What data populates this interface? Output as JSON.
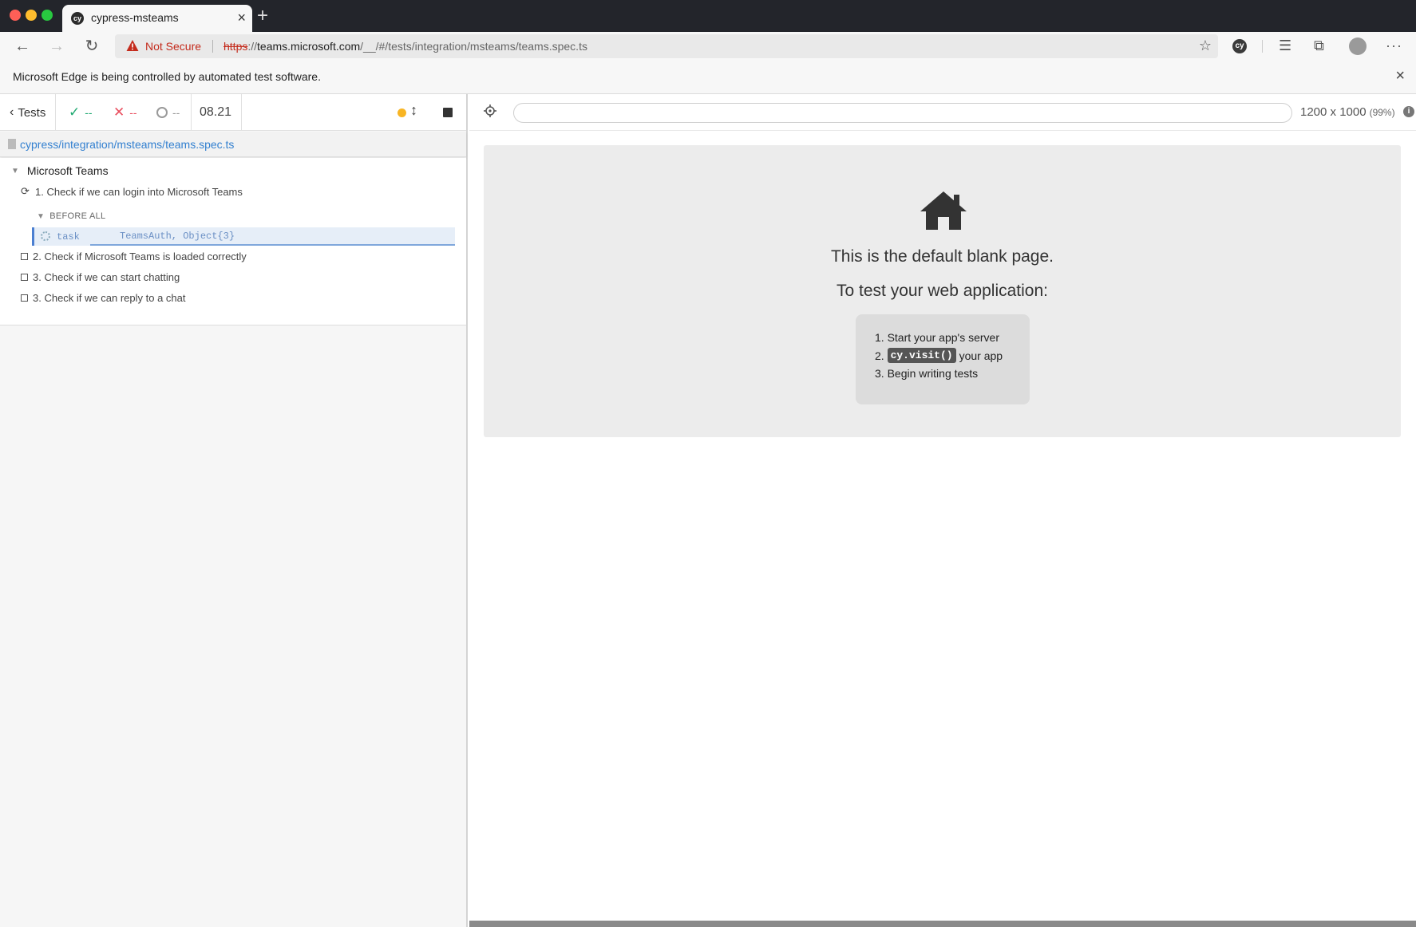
{
  "browser": {
    "tab_title": "cypress-msteams",
    "tab_favicon": "cy",
    "new_tab": "+",
    "tab_close": "×",
    "security_label": "Not Secure",
    "url_scheme": "https",
    "url_sep": "://",
    "url_host": "teams.microsoft.com",
    "url_path": "/__/#/tests/integration/msteams/teams.spec.ts",
    "extension_label": "cy",
    "icons": [
      "back-arrow-icon",
      "forward-arrow-icon",
      "reload-icon",
      "warning-icon",
      "star-icon",
      "favorites-icon",
      "collections-icon",
      "profile-icon",
      "more-icon"
    ]
  },
  "banner": {
    "text": "Microsoft Edge is being controlled by automated test software.",
    "close": "×"
  },
  "reporter": {
    "tests_label": "Tests",
    "passed": "--",
    "failed": "--",
    "pending": "--",
    "duration": "08.21",
    "spec_path": "cypress/integration/msteams/teams.spec.ts",
    "suite": "Microsoft Teams",
    "tests": [
      {
        "title": "1. Check if we can login into Microsoft Teams",
        "state": "running"
      },
      {
        "title": "2. Check if Microsoft Teams is loaded correctly",
        "state": "pending"
      },
      {
        "title": "3. Check if we can start chatting",
        "state": "pending"
      },
      {
        "title": "3. Check if we can reply to a chat",
        "state": "pending"
      }
    ],
    "hook": "BEFORE ALL",
    "command": {
      "name": "task",
      "message": "TeamsAuth, Object{3}"
    },
    "colors": {
      "passed": "#1fa971",
      "failed": "#e94f5f",
      "running": "#f8b524",
      "link": "#3380d0"
    }
  },
  "aut": {
    "url_value": "",
    "viewport": "1200 x 1000",
    "scale": "(99%)",
    "blank_title": "This is the default blank page.",
    "blank_subtitle": "To test your web application:",
    "steps": [
      {
        "num": "1.",
        "text": "Start your app's server"
      },
      {
        "num": "2.",
        "code": "cy.visit()",
        "text": "your app"
      },
      {
        "num": "3.",
        "text": "Begin writing tests"
      }
    ]
  }
}
